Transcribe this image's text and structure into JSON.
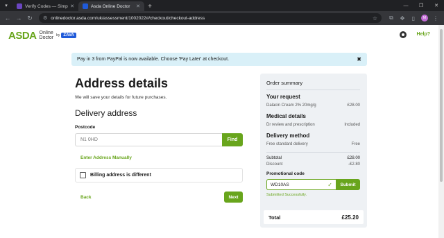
{
  "browser": {
    "tabs": [
      {
        "title": "Verify Codes — SimplyCodes",
        "favicon_color": "#6b46c1"
      },
      {
        "title": "Asda Online Doctor",
        "favicon_color": "#1f5ad9"
      }
    ],
    "url": "onlinedoctor.asda.com/uk/assessment/1002022#/checkout/checkout-address",
    "profile_initial": "M"
  },
  "header": {
    "logo_asda": "ASDA",
    "logo_online": "Online",
    "logo_doctor": "Doctor",
    "logo_by": "by",
    "logo_zava": "ZAVA",
    "help": "Help?"
  },
  "banner": {
    "text": "Pay in 3 from PayPal is now available. Choose 'Pay Later' at checkout.",
    "close": "✖"
  },
  "address": {
    "title": "Address details",
    "subtitle": "We will save your details for future purchases.",
    "delivery_heading": "Delivery address",
    "postcode_label": "Postcode",
    "postcode_value": "N1 0HD",
    "find_button": "Find",
    "manual_link": "Enter Address Manually",
    "billing_label": "Billing address is different",
    "back": "Back",
    "next": "Next"
  },
  "summary": {
    "title": "Order summary",
    "request_heading": "Your request",
    "request_item": "Dalacin Cream 2% 20mg/g",
    "request_price": "£28.00",
    "medical_heading": "Medical details",
    "medical_item": "Dr review and prescription",
    "medical_value": "Included",
    "delivery_heading": "Delivery method",
    "delivery_item": "Free standard delivery",
    "delivery_value": "Free",
    "subtotal_label": "Subtotal",
    "subtotal_value": "£28.00",
    "discount_label": "Discount",
    "discount_value": "-£2.80",
    "promo_label": "Promotional code",
    "promo_value": "WD10AS",
    "promo_button": "Submit",
    "promo_message": "Submitted Successfully.",
    "total_label": "Total",
    "total_value": "£25.20"
  },
  "colors": {
    "brand_green": "#68a51c",
    "banner_bg": "#d9f0f8",
    "summary_bg": "#eef1f4",
    "zava_blue": "#1f5ad9"
  }
}
